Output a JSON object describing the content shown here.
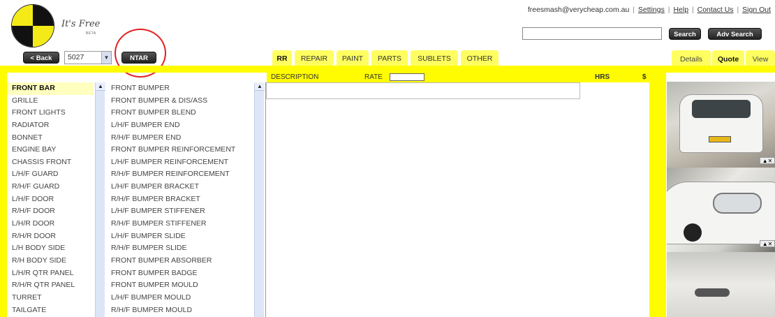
{
  "app": {
    "tagline": "It's Free",
    "beta_label": "BETA"
  },
  "header": {
    "user_email": "freesmash@verycheap.com.au",
    "links": [
      "Settings",
      "Help",
      "Contact Us",
      "Sign Out"
    ],
    "search_placeholder": "",
    "search_label": "Search",
    "adv_search_label": "Adv Search"
  },
  "toolbar": {
    "back_label": "< Back",
    "job_select_value": "5027",
    "ntar_label": "NTAR"
  },
  "tabs": [
    "RR",
    "REPAIR",
    "PAINT",
    "PARTS",
    "SUBLETS",
    "OTHER"
  ],
  "active_tab": "RR",
  "right_tabs": [
    "Details",
    "Quote",
    "View"
  ],
  "active_right_tab": "Quote",
  "columns": {
    "description": "DESCRIPTION",
    "rate": "RATE",
    "hrs": "HRS",
    "dollar": "$"
  },
  "sections": [
    "FRONT BAR",
    "GRILLE",
    "FRONT LIGHTS",
    "RADIATOR",
    "BONNET",
    "ENGINE BAY",
    "CHASSIS FRONT",
    "L/H/F GUARD",
    "R/H/F GUARD",
    "L/H/F DOOR",
    "R/H/F DOOR",
    "L/H/R DOOR",
    "R/H/R DOOR",
    "L/H BODY SIDE",
    "R/H BODY SIDE",
    "L/H/R QTR PANEL",
    "R/H/R QTR PANEL",
    "TURRET",
    "TAILGATE"
  ],
  "parts": [
    "FRONT BUMPER",
    "FRONT BUMPER & DIS/ASS",
    "FRONT BUMPER BLEND",
    "L/H/F BUMPER END",
    "R/H/F BUMPER END",
    "FRONT BUMPER REINFORCEMENT",
    "L/H/F BUMPER REINFORCEMENT",
    "R/H/F BUMPER REINFORCEMENT",
    "L/H/F BUMPER BRACKET",
    "R/H/F BUMPER BRACKET",
    "L/H/F BUMPER STIFFENER",
    "R/H/F BUMPER STIFFENER",
    "L/H/F BUMPER SLIDE",
    "R/H/F BUMPER SLIDE",
    "FRONT BUMPER ABSORBER",
    "FRONT BUMPER BADGE",
    "FRONT BUMPER MOULD",
    "L/H/F BUMPER MOULD",
    "R/H/F BUMPER MOULD"
  ],
  "icons": {
    "scroll_up": "▲",
    "dropdown": "▼",
    "photo_up": "▲",
    "photo_delete": "✕"
  },
  "colors": {
    "accent_yellow": "#fffb00",
    "tab_yellow": "#fffe60",
    "scrollbar": "#dde6f7",
    "annotation_red": "#e02020"
  }
}
